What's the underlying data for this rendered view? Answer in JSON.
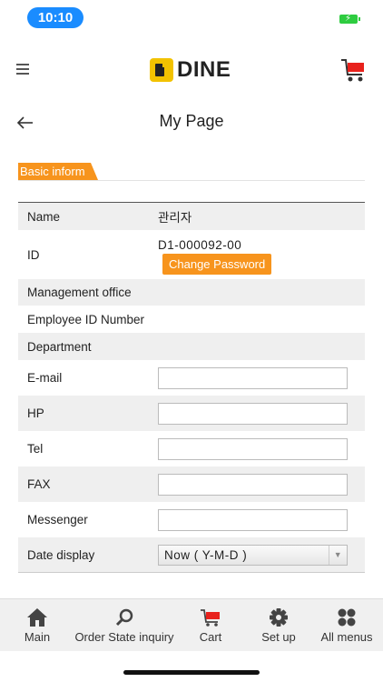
{
  "status_bar": {
    "time": "10:10",
    "battery_color": "#2ecc40",
    "time_pill_color": "#1a8cff"
  },
  "header": {
    "logo_text": "DINE",
    "menu_icon": "hamburger-icon",
    "cart_icon": "cart-icon"
  },
  "page": {
    "title": "My Page",
    "back_icon": "back-arrow-icon"
  },
  "section": {
    "tab_label": "Basic inform",
    "accent": "#f7941d"
  },
  "info_rows": {
    "name": {
      "label": "Name",
      "value": "관리자"
    },
    "id": {
      "label": "ID",
      "value": "D1-000092-00",
      "button": "Change Password"
    },
    "management_office": {
      "label": "Management office",
      "value": ""
    },
    "employee_id": {
      "label": "Employee ID Number",
      "value": ""
    },
    "department": {
      "label": "Department",
      "value": ""
    },
    "email": {
      "label": "E-mail",
      "value": ""
    },
    "hp": {
      "label": "HP",
      "value": ""
    },
    "tel": {
      "label": "Tel",
      "value": ""
    },
    "fax": {
      "label": "FAX",
      "value": ""
    },
    "messenger": {
      "label": "Messenger",
      "value": ""
    },
    "date_display": {
      "label": "Date display",
      "selected": "Now ( Y-M-D )"
    }
  },
  "bottom_nav": [
    {
      "label": "Main",
      "icon": "home-icon"
    },
    {
      "label": "Order State inquiry",
      "icon": "search-icon"
    },
    {
      "label": "Cart",
      "icon": "cart-icon"
    },
    {
      "label": "Set up",
      "icon": "gear-icon"
    },
    {
      "label": "All menus",
      "icon": "grid-icon"
    }
  ]
}
